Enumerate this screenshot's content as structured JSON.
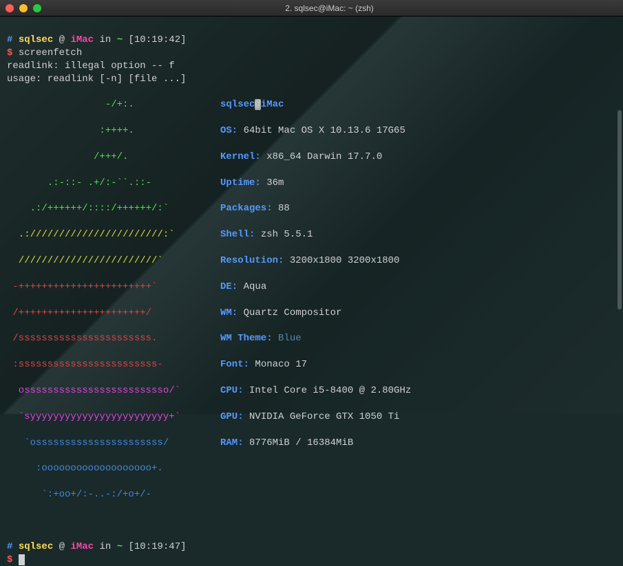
{
  "titlebar": {
    "title": "2. sqlsec@iMac: ~ (zsh)"
  },
  "prompt1": {
    "hash": "#",
    "user": "sqlsec",
    "at": "@",
    "host": "iMac",
    "in": "in",
    "path": "~",
    "time": "[10:19:42]",
    "dollar": "$",
    "command": "screenfetch"
  },
  "errors": {
    "line1": "readlink: illegal option -- f",
    "line2": "usage: readlink [-n] [file ...]"
  },
  "logo": {
    "l0": "                 -/+:.",
    "l1": "                :++++.",
    "l2": "               /+++/.",
    "l3": "       .:-::- .+/:-``.::-",
    "l4": "    .:/++++++/::::/++++++/:`",
    "l5": "  .:///////////////////////:`",
    "l6": "  ////////////////////////`",
    "l7": " -+++++++++++++++++++++++`",
    "l8": " /++++++++++++++++++++++/",
    "l9": " /sssssssssssssssssssssss.",
    "l10": " :ssssssssssssssssssssssss-",
    "l11": "  osssssssssssssssssssssssso/`",
    "l12": "  `syyyyyyyyyyyyyyyyyyyyyyyy+`",
    "l13": "   `ossssssssssssssssssssss/",
    "l14": "     :ooooooooooooooooooo+.",
    "l15": "      `:+oo+/:-..-:/+o+/-"
  },
  "sysinfo": {
    "user": "sqlsec",
    "at": "@",
    "host": "iMac",
    "os_label": "OS:",
    "os_val": "64bit Mac OS X 10.13.6 17G65",
    "kernel_label": "Kernel:",
    "kernel_val": "x86_64 Darwin 17.7.0",
    "uptime_label": "Uptime:",
    "uptime_val": "36m",
    "packages_label": "Packages:",
    "packages_val": "88",
    "shell_label": "Shell:",
    "shell_val": "zsh 5.5.1",
    "resolution_label": "Resolution:",
    "resolution_val": "3200x1800 3200x1800",
    "de_label": "DE:",
    "de_val": "Aqua",
    "wm_label": "WM:",
    "wm_val": "Quartz Compositor",
    "wmtheme_label": "WM Theme:",
    "wmtheme_val": "Blue",
    "font_label": "Font:",
    "font_val": "Monaco 17",
    "cpu_label": "CPU:",
    "cpu_val": "Intel Core i5-8400 @ 2.80GHz",
    "gpu_label": "GPU:",
    "gpu_val": "NVIDIA GeForce GTX 1050 Ti",
    "ram_label": "RAM:",
    "ram_val": "8776MiB / 16384MiB"
  },
  "prompt2": {
    "hash": "#",
    "user": "sqlsec",
    "at": "@",
    "host": "iMac",
    "in": "in",
    "path": "~",
    "time": "[10:19:47]",
    "dollar": "$"
  }
}
